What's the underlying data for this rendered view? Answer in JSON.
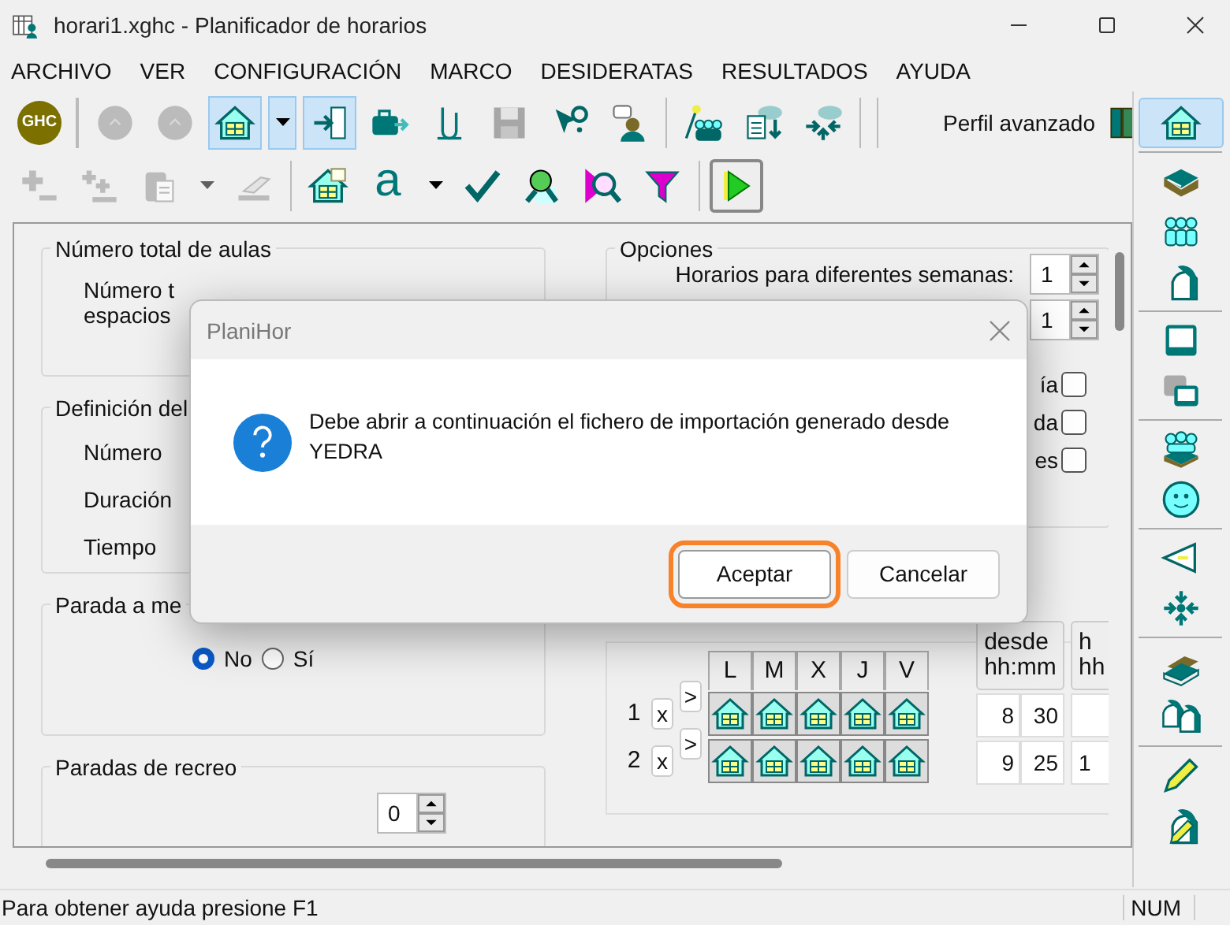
{
  "window": {
    "title": "horari1.xghc - Planificador de horarios"
  },
  "menu": [
    "ARCHIVO",
    "VER",
    "CONFIGURACIÓN",
    "MARCO",
    "DESIDERATAS",
    "RESULTADOS",
    "AYUDA"
  ],
  "toolbar_1": {
    "groups": [
      {
        "buttons": [
          {
            "kind": "logo",
            "text": "GHC",
            "selected": false,
            "disabled": false
          }
        ]
      },
      {
        "buttons": [
          {
            "kind": "icon",
            "selected": false,
            "disabled": true
          },
          {
            "kind": "icon",
            "selected": false,
            "disabled": true
          },
          {
            "kind": "icon",
            "selected": true,
            "disabled": false
          },
          {
            "kind": "caret",
            "selected": true,
            "disabled": false
          },
          {
            "kind": "icon",
            "selected": true,
            "disabled": false
          },
          {
            "kind": "icon",
            "selected": false,
            "disabled": false
          },
          {
            "kind": "icon",
            "selected": false,
            "disabled": false
          },
          {
            "kind": "icon",
            "selected": false,
            "disabled": true
          },
          {
            "kind": "icon",
            "selected": false,
            "disabled": false
          },
          {
            "kind": "icon",
            "selected": false,
            "disabled": false
          }
        ]
      },
      {
        "buttons": [
          {
            "kind": "icon",
            "selected": false,
            "disabled": false
          },
          {
            "kind": "icon",
            "selected": false,
            "disabled": false
          },
          {
            "kind": "icon",
            "selected": false,
            "disabled": false
          }
        ]
      },
      {
        "buttons": [
          {
            "kind": "label",
            "text": "Perfil avanzado",
            "selected": false,
            "disabled": false
          }
        ]
      }
    ]
  },
  "toolbar_2": {
    "groups": [
      {
        "buttons": [
          {
            "kind": "icon",
            "selected": false,
            "disabled": true
          },
          {
            "kind": "icon",
            "selected": false,
            "disabled": true
          },
          {
            "kind": "icon",
            "selected": false,
            "disabled": true
          },
          {
            "kind": "caret",
            "selected": false,
            "disabled": true
          },
          {
            "kind": "icon",
            "selected": false,
            "disabled": true
          }
        ]
      },
      {
        "buttons": [
          {
            "kind": "icon",
            "selected": false,
            "disabled": false
          },
          {
            "kind": "letter",
            "text": "a",
            "selected": false,
            "disabled": false
          },
          {
            "kind": "caret",
            "selected": false,
            "disabled": false
          },
          {
            "kind": "icon",
            "selected": false,
            "disabled": false
          },
          {
            "kind": "icon",
            "selected": false,
            "disabled": false
          },
          {
            "kind": "icon",
            "selected": false,
            "disabled": false
          },
          {
            "kind": "icon",
            "selected": false,
            "disabled": false
          }
        ]
      },
      {
        "buttons": [
          {
            "kind": "framed",
            "selected": false,
            "disabled": false
          }
        ]
      }
    ]
  },
  "sidebar": {
    "groups": [
      {
        "buttons": [
          {
            "selected": true
          }
        ]
      },
      {
        "buttons": [
          {
            "selected": false
          },
          {
            "selected": false
          },
          {
            "selected": false
          }
        ]
      },
      {
        "buttons": [
          {
            "selected": false
          },
          {
            "selected": false
          }
        ]
      },
      {
        "buttons": [
          {
            "selected": false
          },
          {
            "selected": false
          }
        ]
      },
      {
        "buttons": [
          {
            "selected": false
          },
          {
            "selected": false
          }
        ]
      },
      {
        "buttons": [
          {
            "selected": false
          },
          {
            "selected": false
          }
        ]
      },
      {
        "buttons": [
          {
            "selected": false
          },
          {
            "selected": false
          }
        ]
      }
    ]
  },
  "form": {
    "groups": [
      {
        "title": "Número total de aulas",
        "labels": [
          "Número t",
          "espacios"
        ]
      },
      {
        "title": "Definición del",
        "labels": [
          "Número",
          "Duración",
          "Tiempo"
        ]
      },
      {
        "title": "Parada a me",
        "radios": [
          {
            "label": "No",
            "selected": true
          },
          {
            "label": "Sí",
            "selected": false
          }
        ]
      },
      {
        "title": "Paradas de recreo",
        "spinner": "0"
      }
    ],
    "options": {
      "title": "Opciones",
      "spinners": [
        {
          "label": "Horarios para diferentes semanas:",
          "value": "1"
        },
        {
          "value": "1"
        }
      ],
      "checkboxes": [
        {
          "label": "ía",
          "checked": false
        },
        {
          "label": "da",
          "checked": false
        },
        {
          "label": "es",
          "checked": false
        }
      ]
    },
    "grid": {
      "days": [
        "L",
        "M",
        "X",
        "J",
        "V"
      ],
      "time_headers": [
        [
          "desde",
          "hh:mm"
        ],
        [
          "h",
          "hh"
        ]
      ],
      "rows": [
        {
          "number": "1",
          "remove": "x",
          "copy": ">",
          "times": [
            "8",
            "30"
          ]
        },
        {
          "number": "2",
          "remove": "x",
          "copy": ">",
          "times": [
            "9",
            "25",
            "1"
          ]
        }
      ]
    }
  },
  "dialog": {
    "title": "PlaniHor",
    "message": "Debe abrir a continuación el fichero de importación generado desde YEDRA",
    "buttons": [
      {
        "label": "Aceptar",
        "focused": true
      },
      {
        "label": "Cancelar",
        "focused": false
      }
    ]
  },
  "status_bar": {
    "message": "Para obtener ayuda presione F1",
    "indicator": "NUM"
  }
}
